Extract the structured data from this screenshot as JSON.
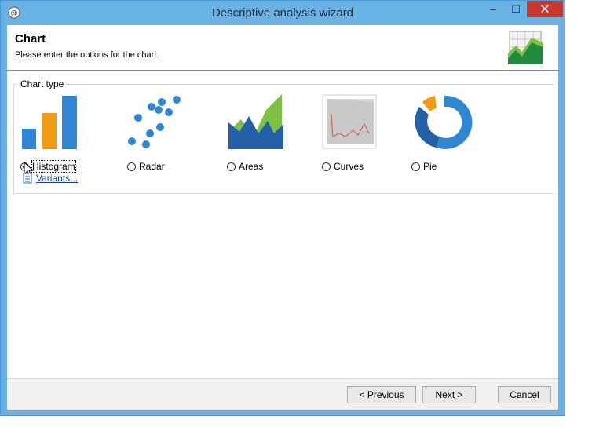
{
  "window": {
    "title": "Descriptive analysis wizard",
    "controls": {
      "minimize": "–",
      "maximize": "☐",
      "close": "✕"
    }
  },
  "header": {
    "title": "Chart",
    "subtitle": "Please enter the options for the chart.",
    "icon": "chart-wizard-icon"
  },
  "chart_type": {
    "legend": "Chart type",
    "selected": "Histogram",
    "options": [
      {
        "label": "Histogram",
        "icon": "histogram-icon",
        "checked": true
      },
      {
        "label": "Radar",
        "icon": "radar-icon",
        "checked": false
      },
      {
        "label": "Areas",
        "icon": "areas-icon",
        "checked": false
      },
      {
        "label": "Curves",
        "icon": "curves-icon",
        "checked": false
      },
      {
        "label": "Pie",
        "icon": "pie-icon",
        "checked": false
      }
    ],
    "variants_link": "Variants..."
  },
  "footer": {
    "previous_label": "< Previous",
    "next_label": "Next >",
    "cancel_label": "Cancel"
  },
  "colors": {
    "title_bar": "#69b2e6",
    "close_button": "#c7392f",
    "chart_blue": "#2f86d3",
    "chart_dark_blue": "#2460a8",
    "chart_orange": "#f39c12",
    "chart_green": "#7dc242"
  }
}
